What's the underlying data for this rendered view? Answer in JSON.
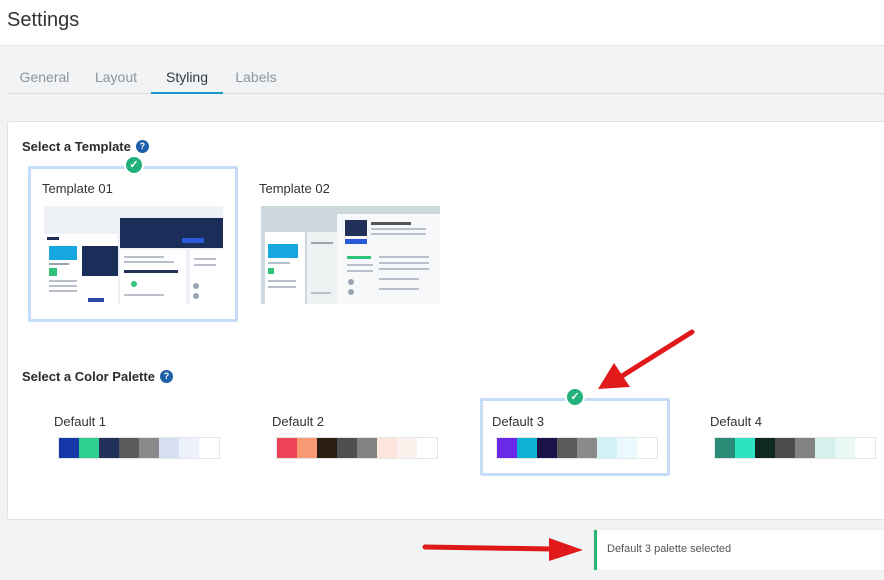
{
  "header": {
    "title": "Settings"
  },
  "tabs": [
    {
      "label": "General"
    },
    {
      "label": "Layout"
    },
    {
      "label": "Styling"
    },
    {
      "label": "Labels"
    }
  ],
  "active_tab": "Styling",
  "templates_section": {
    "title": "Select a Template",
    "items": [
      {
        "label": "Template 01"
      },
      {
        "label": "Template 02"
      }
    ],
    "selected": "Template 01"
  },
  "palettes_section": {
    "title": "Select a Color Palette",
    "items": [
      {
        "label": "Default 1",
        "colors": [
          "#1537a8",
          "#2fd08e",
          "#22315a",
          "#5a5a5a",
          "#8a8a8a",
          "#d7dff2",
          "#edf1fb",
          "#ffffff"
        ]
      },
      {
        "label": "Default 2",
        "colors": [
          "#f0435a",
          "#f99a75",
          "#2a1d12",
          "#4e4e4e",
          "#828282",
          "#fde4dd",
          "#fdf1ee",
          "#ffffff"
        ]
      },
      {
        "label": "Default 3",
        "colors": [
          "#6a28e8",
          "#0fb3d6",
          "#1d1247",
          "#5a5a5a",
          "#8a8a8a",
          "#d0f2f6",
          "#eaf9fb",
          "#ffffff"
        ]
      },
      {
        "label": "Default 4",
        "colors": [
          "#2a8a76",
          "#2ee3bf",
          "#10291f",
          "#4c4c4c",
          "#838383",
          "#d5f1eb",
          "#eaf8f5",
          "#ffffff"
        ]
      }
    ],
    "selected": "Default 3"
  },
  "toast": {
    "message": "Default 3 palette selected",
    "accent_color": "#2bb673"
  },
  "colors": {
    "accent": "#1796c9",
    "selection_border": "#c5ddf6",
    "check": "#22b07b",
    "help": "#1d5fa8",
    "annotation_arrow": "#e0191b"
  },
  "icons": {
    "help": "question-circle-icon",
    "check": "check-circle-icon",
    "annotation": "red-arrow-icon"
  }
}
